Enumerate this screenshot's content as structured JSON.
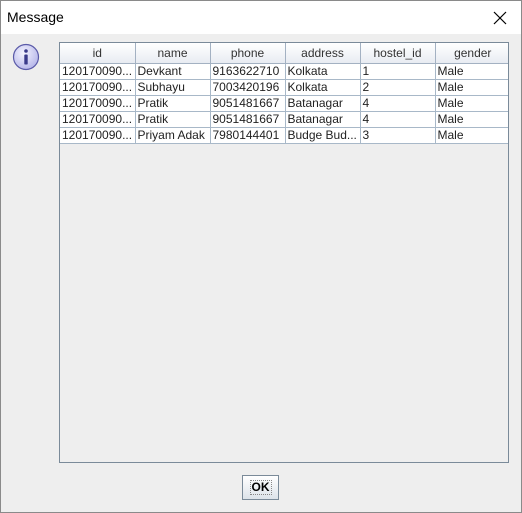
{
  "window": {
    "title": "Message"
  },
  "icons": {
    "message_icon": "info-icon",
    "close_icon": "close-icon"
  },
  "colors": {
    "info_icon_fill": "#c9c9f0",
    "info_icon_stroke": "#5a5aa8",
    "header_border": "#a3b1c2"
  },
  "table": {
    "columns": [
      "id",
      "name",
      "phone",
      "address",
      "hostel_id",
      "gender"
    ],
    "rows": [
      [
        "120170090...",
        "Devkant",
        "9163622710",
        "Kolkata",
        "1",
        "Male"
      ],
      [
        "120170090...",
        "Subhayu",
        "7003420196",
        "Kolkata",
        "2",
        "Male"
      ],
      [
        "120170090...",
        "Pratik",
        "9051481667",
        "Batanagar",
        "4",
        "Male"
      ],
      [
        "120170090...",
        "Pratik",
        "9051481667",
        "Batanagar",
        "4",
        "Male"
      ],
      [
        "120170090...",
        "Priyam Adak",
        "7980144401",
        "Budge Bud...",
        "3",
        "Male"
      ]
    ]
  },
  "buttons": {
    "ok_label": "OK"
  }
}
